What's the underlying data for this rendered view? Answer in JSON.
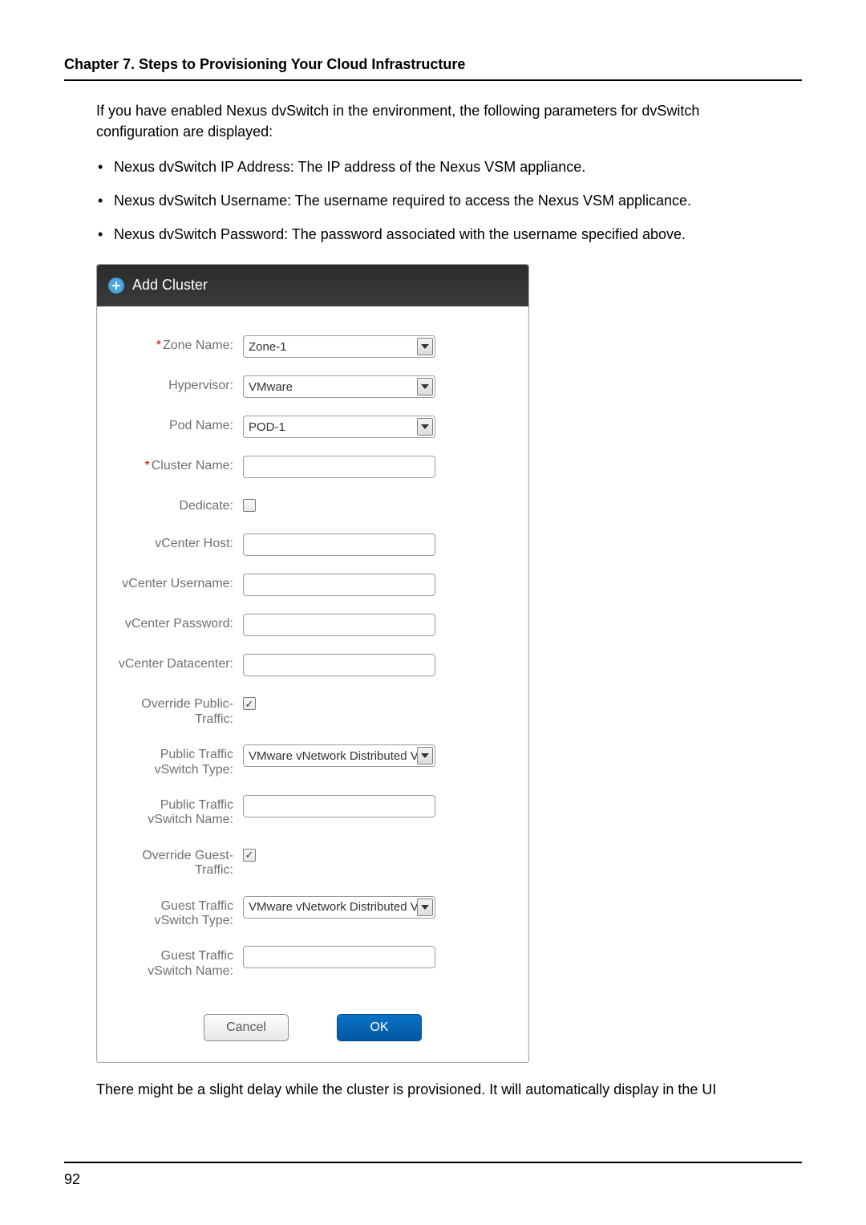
{
  "chapter_header": "Chapter 7. Steps to Provisioning Your Cloud Infrastructure",
  "intro_para": "If you have enabled Nexus dvSwitch in the environment, the following parameters for dvSwitch configuration are displayed:",
  "bullets": [
    "Nexus dvSwitch IP Address: The IP address of the Nexus VSM appliance.",
    "Nexus dvSwitch Username: The username required to access the Nexus VSM applicance.",
    "Nexus dvSwitch Password: The password associated with the username specified above."
  ],
  "dialog": {
    "title": "Add Cluster",
    "zone_name_label": "Zone Name:",
    "zone_name_value": "Zone-1",
    "hypervisor_label": "Hypervisor:",
    "hypervisor_value": "VMware",
    "pod_name_label": "Pod Name:",
    "pod_name_value": "POD-1",
    "cluster_name_label": "Cluster Name:",
    "cluster_name_value": "",
    "dedicate_label": "Dedicate:",
    "dedicate_checked": false,
    "vcenter_host_label": "vCenter Host:",
    "vcenter_host_value": "",
    "vcenter_user_label": "vCenter Username:",
    "vcenter_user_value": "",
    "vcenter_pw_label": "vCenter Password:",
    "vcenter_pw_value": "",
    "vcenter_dc_label": "vCenter Datacenter:",
    "vcenter_dc_value": "",
    "override_public_label": "Override Public-\nTraffic:",
    "override_public_checked": true,
    "public_vswitch_type_label": "Public Traffic vSwitch Type:",
    "public_vswitch_type_value": "VMware vNetwork Distributed Virtu",
    "public_vswitch_name_label": "Public Traffic vSwitch Name:",
    "public_vswitch_name_value": "",
    "override_guest_label": "Override Guest-\nTraffic:",
    "override_guest_checked": true,
    "guest_vswitch_type_label": "Guest Traffic vSwitch Type:",
    "guest_vswitch_type_value": "VMware vNetwork Distributed Virtu",
    "guest_vswitch_name_label": "Guest Traffic vSwitch Name:",
    "guest_vswitch_name_value": "",
    "cancel_label": "Cancel",
    "ok_label": "OK"
  },
  "after_para": "There might be a slight delay while the cluster is provisioned. It will automatically display in the UI",
  "page_number": "92"
}
